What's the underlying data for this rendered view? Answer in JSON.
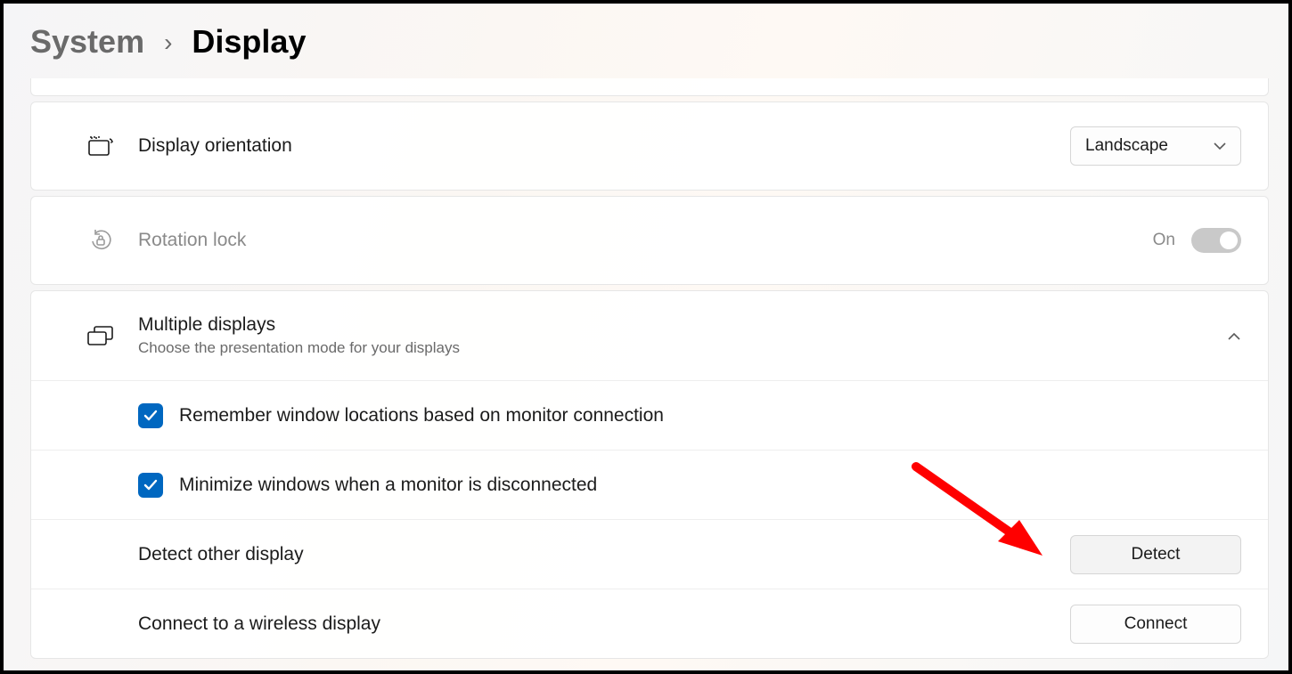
{
  "breadcrumb": {
    "parent": "System",
    "chev": "›",
    "current": "Display"
  },
  "orientation": {
    "title": "Display orientation",
    "value": "Landscape"
  },
  "rotation": {
    "title": "Rotation lock",
    "state_label": "On"
  },
  "multiple": {
    "title": "Multiple displays",
    "subtitle": "Choose the presentation mode for your displays"
  },
  "opts": {
    "remember": "Remember window locations based on monitor connection",
    "minimize": "Minimize windows when a monitor is disconnected",
    "detect_label": "Detect other display",
    "detect_btn": "Detect",
    "wireless_label": "Connect to a wireless display",
    "connect_btn": "Connect"
  }
}
